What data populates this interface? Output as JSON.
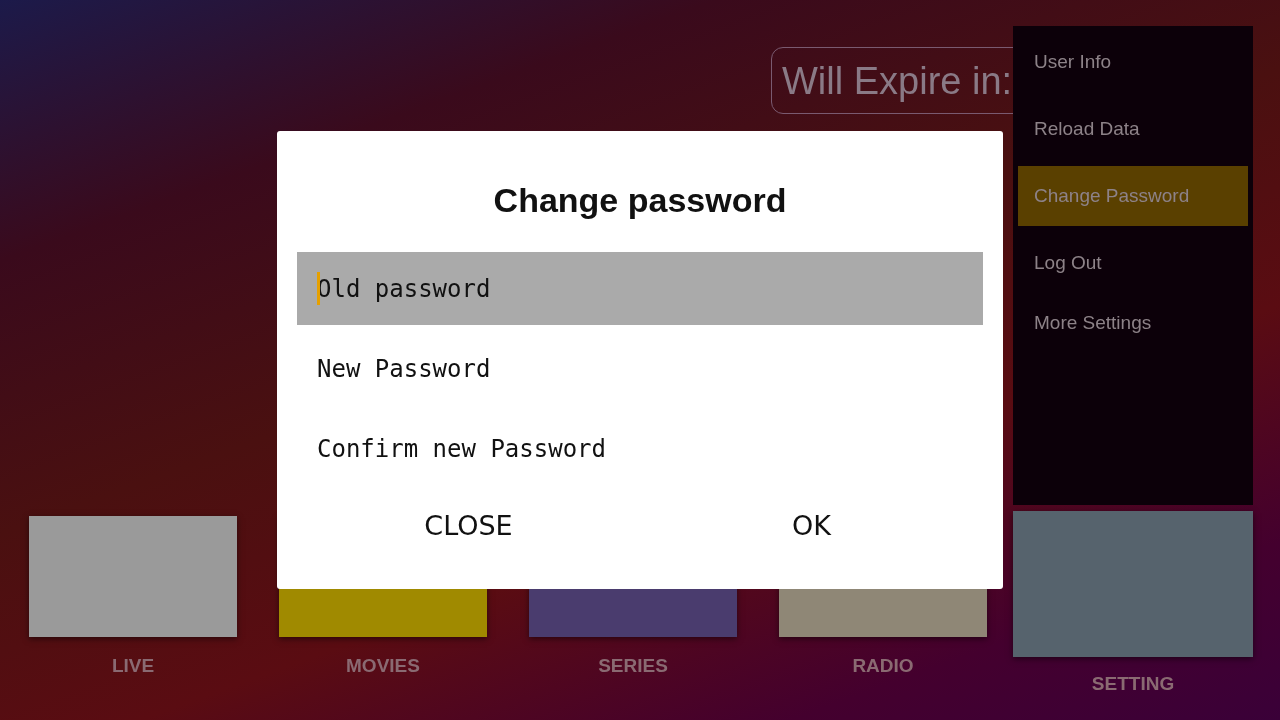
{
  "expiry": {
    "label": "Will Expire in:"
  },
  "tiles": [
    {
      "label": "LIVE",
      "selected": false
    },
    {
      "label": "MOVIES",
      "selected": false
    },
    {
      "label": "SERIES",
      "selected": false
    },
    {
      "label": "RADIO",
      "selected": false
    },
    {
      "label": "SETTING",
      "selected": true
    }
  ],
  "menu": {
    "items": [
      {
        "label": "User Info",
        "selected": false
      },
      {
        "label": "Reload Data",
        "selected": false
      },
      {
        "label": "Change Password",
        "selected": true
      },
      {
        "label": "Log Out",
        "selected": false
      },
      {
        "label": "More Settings",
        "selected": false
      }
    ]
  },
  "dialog": {
    "title": "Change password",
    "fields": [
      {
        "placeholder": "Old password",
        "focused": true
      },
      {
        "placeholder": "New Password",
        "focused": false
      },
      {
        "placeholder": "Confirm new Password",
        "focused": false
      }
    ],
    "buttons": [
      "CLOSE",
      "OK"
    ]
  }
}
